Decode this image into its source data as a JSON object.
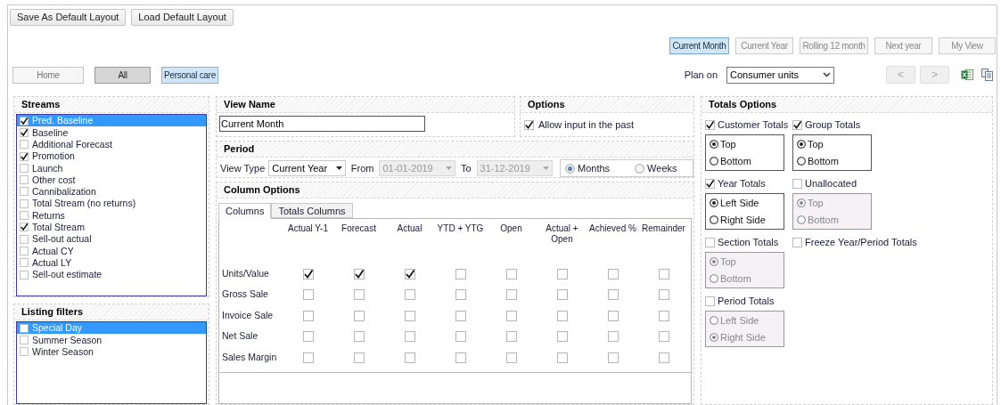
{
  "layout_buttons": [
    "Save As Default Layout",
    "Load Default Layout"
  ],
  "period_buttons": [
    {
      "label": "Current Month",
      "selected": true
    },
    {
      "label": "Current Year",
      "selected": false
    },
    {
      "label": "Rolling 12 month",
      "selected": false
    },
    {
      "label": "Next year",
      "selected": false
    },
    {
      "label": "My View",
      "selected": false
    }
  ],
  "scope_buttons": [
    {
      "label": "Home",
      "kind": "plain"
    },
    {
      "label": "All",
      "kind": "pressed"
    },
    {
      "label": "Personal care",
      "kind": "active"
    }
  ],
  "plan_on": {
    "label": "Plan on",
    "value": "Consumer units"
  },
  "nav_buttons": [
    {
      "label": "<",
      "disabled": true
    },
    {
      "label": ">",
      "disabled": true
    }
  ],
  "streams": {
    "title": "Streams",
    "items": [
      {
        "label": "Pred. Baseline",
        "checked": true,
        "selected": true
      },
      {
        "label": "Baseline",
        "checked": true,
        "selected": false
      },
      {
        "label": "Additional Forecast",
        "checked": false,
        "selected": false
      },
      {
        "label": "Promotion",
        "checked": true,
        "selected": false
      },
      {
        "label": "Launch",
        "checked": false,
        "selected": false
      },
      {
        "label": "Other cost",
        "checked": false,
        "selected": false
      },
      {
        "label": "Cannibalization",
        "checked": false,
        "selected": false
      },
      {
        "label": "Total Stream (no returns)",
        "checked": false,
        "selected": false
      },
      {
        "label": "Returns",
        "checked": false,
        "selected": false
      },
      {
        "label": "Total Stream",
        "checked": true,
        "selected": false
      },
      {
        "label": "Sell-out actual",
        "checked": false,
        "selected": false
      },
      {
        "label": "Actual CY",
        "checked": false,
        "selected": false
      },
      {
        "label": "Actual LY",
        "checked": false,
        "selected": false
      },
      {
        "label": "Sell-out estimate",
        "checked": false,
        "selected": false
      }
    ]
  },
  "listing_filters": {
    "title": "Listing filters",
    "items": [
      {
        "label": "Special Day",
        "checked": false,
        "selected": true
      },
      {
        "label": "Summer Season",
        "checked": false,
        "selected": false
      },
      {
        "label": "Winter Season",
        "checked": false,
        "selected": false
      }
    ]
  },
  "view_name": {
    "title": "View Name",
    "value": "Current Month"
  },
  "options": {
    "title": "Options",
    "allow_input": {
      "label": "Allow input in the past",
      "checked": true
    }
  },
  "period": {
    "title": "Period",
    "view_type_label": "View Type",
    "view_type": "Current Year",
    "from_label": "From",
    "from": "01-01-2019",
    "to_label": "To",
    "to": "31-12-2019",
    "granularity": [
      {
        "label": "Months",
        "selected": true
      },
      {
        "label": "Weeks",
        "selected": false
      }
    ]
  },
  "column_options": {
    "title": "Column Options",
    "tabs": [
      {
        "label": "Columns",
        "selected": true
      },
      {
        "label": "Totals Columns",
        "selected": false
      }
    ],
    "columns": [
      "Actual Y-1",
      "Forecast",
      "Actual",
      "YTD + YTG",
      "Open",
      "Actual + Open",
      "Achieved %",
      "Remainder"
    ],
    "rows": [
      {
        "label": "Units/Value",
        "checked": [
          true,
          true,
          true,
          false,
          false,
          false,
          false,
          false
        ]
      },
      {
        "label": "Gross Sale",
        "checked": [
          false,
          false,
          false,
          false,
          false,
          false,
          false,
          false
        ]
      },
      {
        "label": "Invoice Sale",
        "checked": [
          false,
          false,
          false,
          false,
          false,
          false,
          false,
          false
        ]
      },
      {
        "label": "Net Sale",
        "checked": [
          false,
          false,
          false,
          false,
          false,
          false,
          false,
          false
        ]
      },
      {
        "label": "Sales Margin",
        "checked": [
          false,
          false,
          false,
          false,
          false,
          false,
          false,
          false
        ]
      }
    ]
  },
  "totals_options": {
    "title": "Totals Options",
    "groups": [
      {
        "label": "Customer Totals",
        "checked": true,
        "options": [
          {
            "label": "Top",
            "selected": true
          },
          {
            "label": "Bottom",
            "selected": false
          }
        ]
      },
      {
        "label": "Group Totals",
        "checked": true,
        "options": [
          {
            "label": "Top",
            "selected": true
          },
          {
            "label": "Bottom",
            "selected": false
          }
        ]
      },
      {
        "label": "Year Totals",
        "checked": true,
        "options": [
          {
            "label": "Left Side",
            "selected": true
          },
          {
            "label": "Right Side",
            "selected": false
          }
        ]
      },
      {
        "label": "Unallocated",
        "checked": false,
        "options": [
          {
            "label": "Top",
            "selected": true
          },
          {
            "label": "Bottom",
            "selected": false
          }
        ]
      },
      {
        "label": "Section Totals",
        "checked": false,
        "options": [
          {
            "label": "Top",
            "selected": true
          },
          {
            "label": "Bottom",
            "selected": false
          }
        ]
      },
      {
        "label": "Freeze Year/Period Totals",
        "checked": false
      },
      {
        "label": "Period Totals",
        "checked": false,
        "options": [
          {
            "label": "Left Side",
            "selected": false
          },
          {
            "label": "Right Side",
            "selected": true
          }
        ]
      }
    ]
  }
}
